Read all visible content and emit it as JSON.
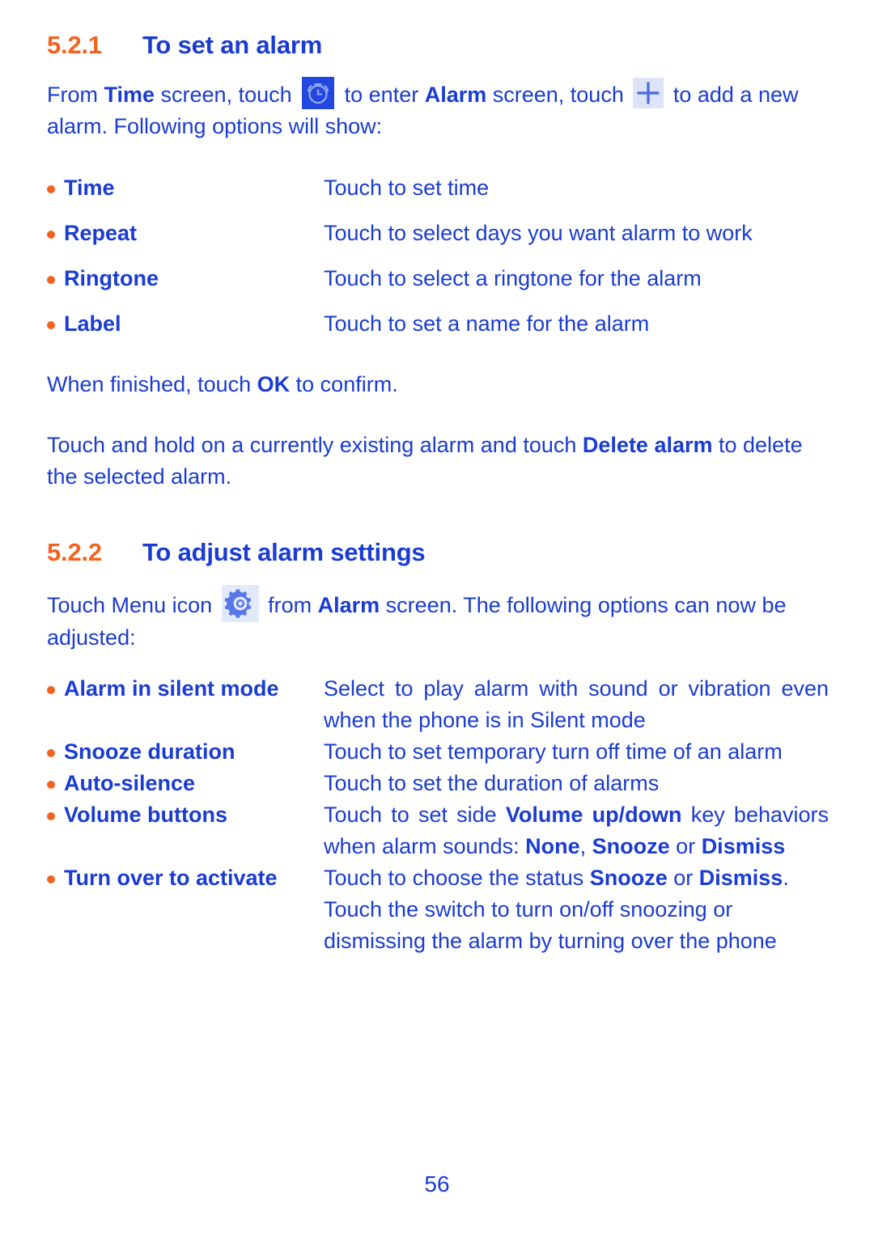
{
  "page": {
    "number": "56",
    "colors": {
      "heading_number": "#f4621f",
      "text_blue": "#1a3cd2",
      "bullet_orange": "#f4621f",
      "alarm_icon_bg": "#2346e0",
      "plus_icon_bg": "#dde4f8",
      "gear_icon_bg": "#e2e9fb"
    }
  },
  "section_1": {
    "number": "5.2.1",
    "title": "To set an alarm",
    "intro": {
      "part1": "From ",
      "bold1": "Time",
      "part2": " screen, touch ",
      "icon1": "alarm-clock-icon",
      "part3": " to enter ",
      "bold2": "Alarm",
      "part4": " screen, touch ",
      "icon2": "plus-icon",
      "part5": " to add a new alarm. Following options will show:"
    },
    "options": [
      {
        "term": "Time",
        "desc": "Touch to set time"
      },
      {
        "term": "Repeat",
        "desc": "Touch to select days you want alarm to work"
      },
      {
        "term": "Ringtone",
        "desc": "Touch to select a ringtone for the alarm"
      },
      {
        "term": "Label",
        "desc": "Touch to set a name for the alarm"
      }
    ],
    "confirm": {
      "part1": "When finished, touch ",
      "bold1": "OK",
      "part2": " to confirm."
    },
    "delete": {
      "part1": "Touch and hold on a currently existing alarm and touch ",
      "bold1": "Delete alarm",
      "part2": " to delete the selected alarm."
    }
  },
  "section_2": {
    "number": "5.2.2",
    "title": "To adjust alarm settings",
    "intro": {
      "part1": "Touch Menu icon ",
      "icon1": "gear-icon",
      "part2": " from ",
      "bold1": "Alarm",
      "part3": " screen. The following options can now be adjusted:"
    },
    "options": [
      {
        "term": "Alarm in silent mode",
        "desc": "Select to play alarm with sound or vibration even when the phone is in Silent mode"
      },
      {
        "term": "Snooze duration",
        "desc": "Touch to set temporary turn off time of an alarm"
      },
      {
        "term": "Auto-silence",
        "desc": "Touch to set the duration of alarms"
      },
      {
        "term": "Volume buttons",
        "desc_part1": "Touch to set side ",
        "desc_bold1": "Volume up/down",
        "desc_part2": " key behaviors when alarm sounds: ",
        "desc_bold2": "None",
        "desc_part3": ", ",
        "desc_bold3": "Snooze",
        "desc_part4": " or ",
        "desc_bold4": "Dismiss"
      },
      {
        "term": "Turn over to activate",
        "desc_part1": "Touch to choose the status ",
        "desc_bold1": "Snooze",
        "desc_part2": " or ",
        "desc_bold2": "Dismiss",
        "desc_part3": ". Touch the switch to turn on/off snoozing or dismissing the alarm by turning over the phone"
      }
    ]
  }
}
